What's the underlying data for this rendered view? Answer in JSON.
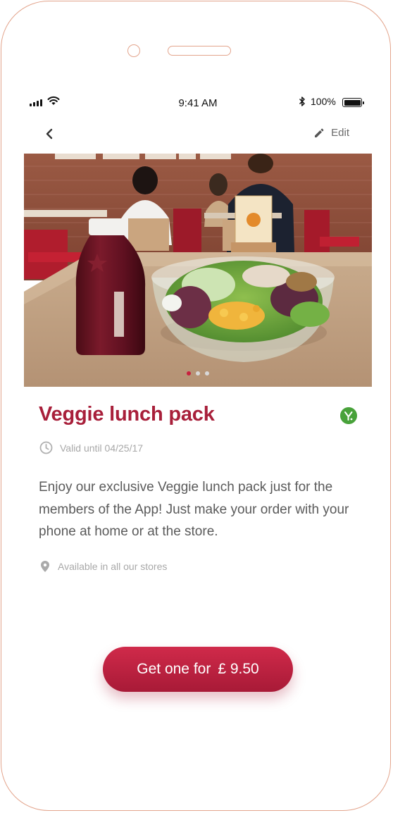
{
  "status_bar": {
    "time": "9:41 AM",
    "battery": "100%"
  },
  "nav": {
    "edit_label": "Edit"
  },
  "carousel": {
    "total": 3,
    "active_index": 0
  },
  "offer": {
    "title": "Veggie lunch pack",
    "validity": "Valid until 04/25/17",
    "description": "Enjoy our exclusive Veggie lunch pack just for the members of the App! Just make your order with your phone at home or at the store.",
    "availability": "Available in all our stores"
  },
  "cta": {
    "label": "Get one for",
    "price": "£ 9.50"
  },
  "colors": {
    "brand": "#a81f3a",
    "button": "#c8203e",
    "veg_badge": "#48a23a",
    "frame": "#e3a48c"
  },
  "icons": {
    "back": "chevron-left-icon",
    "edit": "pencil-icon",
    "clock": "clock-icon",
    "location": "location-pin-icon",
    "veg": "vegetarian-icon"
  }
}
